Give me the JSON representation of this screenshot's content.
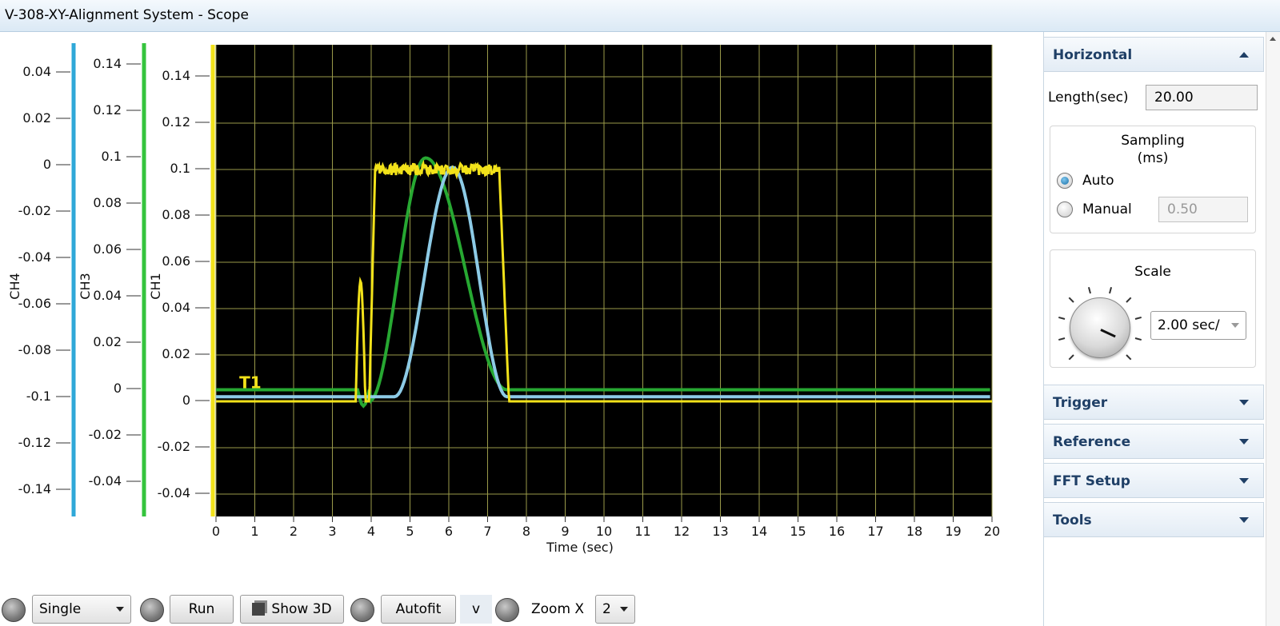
{
  "window": {
    "title": "V-308-XY-Alignment System - Scope"
  },
  "scope": {
    "background": "#000000",
    "grid_color": "#9a9a4a",
    "annotation": "T1",
    "x_axis": {
      "label": "Time (sec)",
      "ticks": [
        "0",
        "1",
        "2",
        "3",
        "4",
        "5",
        "6",
        "7",
        "8",
        "9",
        "10",
        "11",
        "12",
        "13",
        "14",
        "15",
        "16",
        "17",
        "18",
        "19",
        "20"
      ]
    },
    "axes": [
      {
        "name": "CH4",
        "color": "#2fa8d8",
        "ticks": [
          "0.04",
          "0.02",
          "0",
          "-0.02",
          "-0.04",
          "-0.06",
          "-0.08",
          "-0.1",
          "-0.12",
          "-0.14"
        ]
      },
      {
        "name": "CH3",
        "color": "#35c43d",
        "ticks": [
          "0.14",
          "0.12",
          "0.1",
          "0.08",
          "0.06",
          "0.04",
          "0.02",
          "0",
          "-0.02",
          "-0.04"
        ]
      },
      {
        "name": "CH1",
        "color": "#f2e21a",
        "ticks": [
          "0.14",
          "0.12",
          "0.1",
          "0.08",
          "0.06",
          "0.04",
          "0.02",
          "0",
          "-0.02",
          "-0.04"
        ]
      }
    ],
    "traces": [
      {
        "name": "CH1",
        "color": "#f2e21a"
      },
      {
        "name": "CH3",
        "color": "#27a832"
      },
      {
        "name": "CH4",
        "color": "#8dcbe6"
      }
    ]
  },
  "toolbar": {
    "mode_select": "Single",
    "run_label": "Run",
    "show3d_label": "Show 3D",
    "autofit_label": "Autofit",
    "v_label": "v",
    "zoom_label": "Zoom X",
    "zoom_value": "2"
  },
  "panel": {
    "horizontal": {
      "header": "Horizontal",
      "length_label": "Length(sec)",
      "length_value": "20.00",
      "sampling_title_line1": "Sampling",
      "sampling_title_line2": "(ms)",
      "auto_label": "Auto",
      "manual_label": "Manual",
      "manual_value": "0.50",
      "auto_selected": true,
      "scale_title": "Scale",
      "scale_value": "2.00 sec/"
    },
    "sections": [
      "Trigger",
      "Reference",
      "FFT Setup",
      "Tools"
    ]
  }
}
